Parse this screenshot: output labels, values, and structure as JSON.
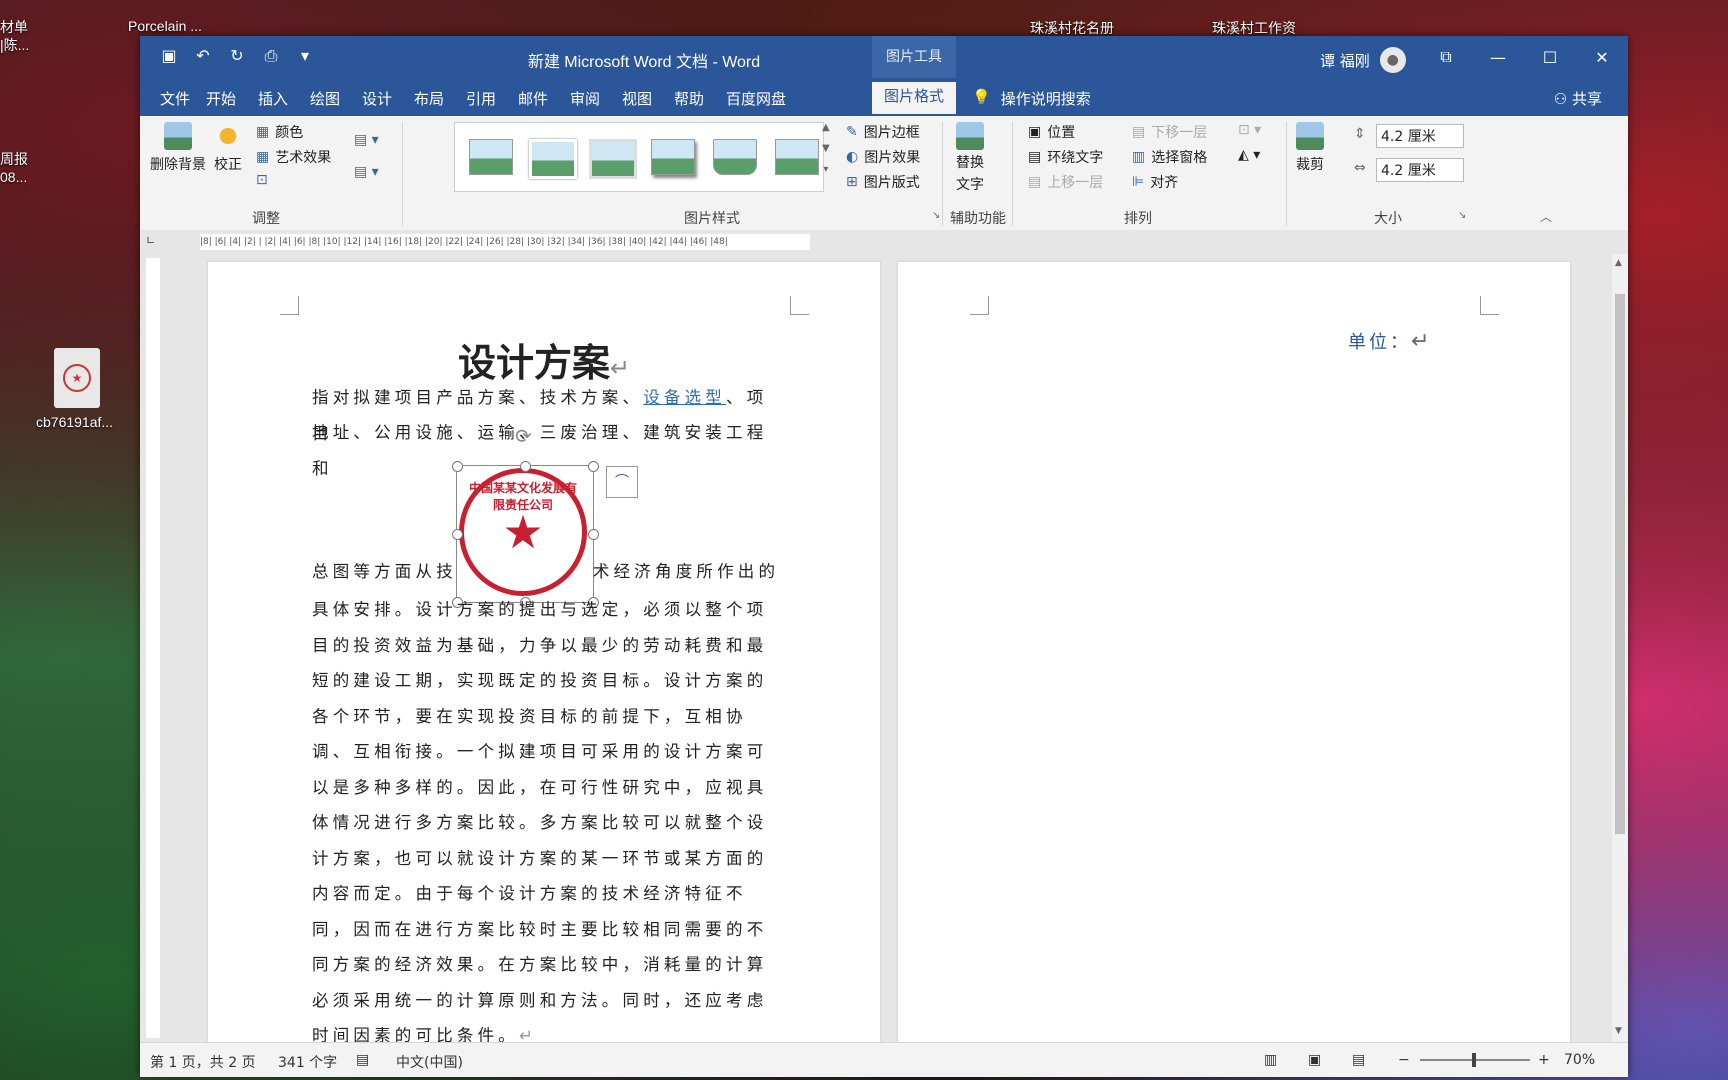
{
  "desktop": {
    "icons": [
      "材单\n|陈...",
      "Porcelain ...",
      "珠溪村花名册",
      "珠溪村工作资",
      "周报\n08...",
      "cb76191af..."
    ]
  },
  "window": {
    "title": "新建 Microsoft Word 文档  -  Word",
    "picture_tools": "图片工具",
    "user": "谭 福刚",
    "tabs": [
      "文件",
      "开始",
      "插入",
      "绘图",
      "设计",
      "布局",
      "引用",
      "邮件",
      "审阅",
      "视图",
      "帮助",
      "百度网盘",
      "图片格式"
    ],
    "tell_me": "操作说明搜索",
    "share": "共享"
  },
  "ribbon": {
    "remove_bg": "删除背景",
    "correct": "校正",
    "color": "颜色",
    "art_effects": "艺术效果",
    "adjust": "调整",
    "pic_border": "图片边框",
    "pic_effects": "图片效果",
    "pic_layout": "图片版式",
    "pic_styles": "图片样式",
    "alt_text_1": "替换",
    "alt_text_2": "文字",
    "accessibility": "辅助功能",
    "position": "位置",
    "wrap_text": "环绕文字",
    "bring_forward": "上移一层",
    "send_backward": "下移一层",
    "selection_pane": "选择窗格",
    "align": "对齐",
    "arrange": "排列",
    "crop": "裁剪",
    "height": "4.2 厘米",
    "width": "4.2 厘米",
    "size": "大小"
  },
  "ruler": "|8| |6| |4| |2| | |2| |4| |6| |8| |10| |12| |14| |16| |18| |20| |22| |24| |26| |28| |30| |32| |34| |36| |38| |40| |42| |44| |46| |48|",
  "document": {
    "title": "设计方案",
    "p1_a": "指对拟建项目产品方案、技术方案、",
    "p1_link": "设备选型",
    "p1_b": "、项目",
    "p2": "地址、公用设施、运输、三废治理、建筑安装工程和",
    "p3_a": "总图等方面从技",
    "p3_b": "术经济角度所作出的",
    "body": "具体安排。设计方案的提出与选定，必须以整个项目的投资效益为基础，力争以最少的劳动耗费和最短的建设工期，实现既定的投资目标。设计方案的各个环节，要在实现投资目标的前提下，互相协调、互相衔接。一个拟建项目可采用的设计方案可以是多种多样的。因此，在可行性研究中，应视具体情况进行多方案比较。多方案比较可以就整个设计方案，也可以就设计方案的某一环节或某方面的内容而定。由于每个设计方案的技术经济特征不同，因而在进行方案比较时主要比较相同需要的不同方案的经济效果。在方案比较中，消耗量的计算必须采用统一的计算原则和方法。同时，还应考虑时间因素的可比条件。",
    "seal_text": "中国某某文化发展有限责任公司",
    "unit_label": "单位："
  },
  "status": {
    "page": "第 1 页，共 2 页",
    "words": "341 个字",
    "lang": "中文(中国)",
    "zoom": "70%"
  }
}
